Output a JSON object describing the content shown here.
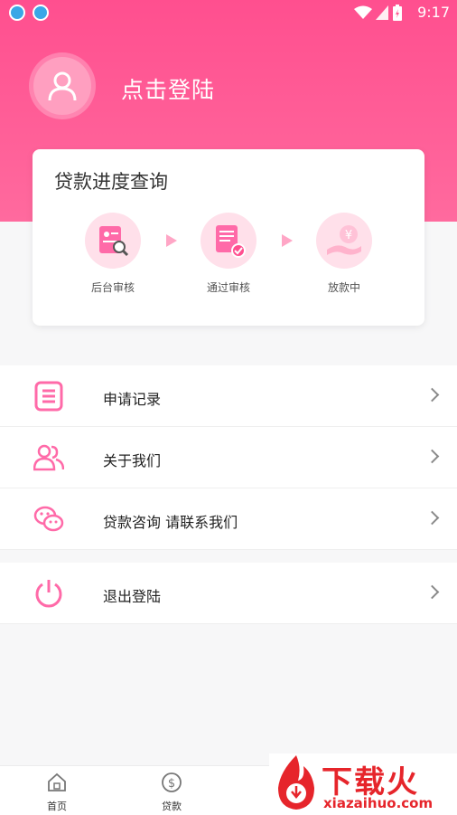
{
  "statusbar": {
    "time": "9:17"
  },
  "header": {
    "login_text": "点击登陆"
  },
  "progress_card": {
    "title": "贷款进度查询",
    "steps": [
      {
        "label": "后台审核",
        "icon": "id-card-search-icon"
      },
      {
        "label": "通过审核",
        "icon": "document-approved-icon"
      },
      {
        "label": "放款中",
        "icon": "yuan-hand-icon"
      }
    ]
  },
  "menu": {
    "items": [
      {
        "label": "申请记录",
        "icon": "list-document-icon"
      },
      {
        "label": "关于我们",
        "icon": "users-icon"
      },
      {
        "label": "贷款咨询 请联系我们",
        "icon": "wechat-icon"
      },
      {
        "label": "退出登陆",
        "icon": "power-icon"
      }
    ]
  },
  "tabbar": {
    "tabs": [
      {
        "label": "首页",
        "icon": "home-icon"
      },
      {
        "label": "贷款",
        "icon": "dollar-circle-icon"
      },
      {
        "label": "",
        "icon": "user-icon"
      }
    ]
  },
  "watermark": {
    "brand": "下载火",
    "url": "xiazaihuo.com"
  },
  "colors": {
    "accent": "#ff5a93",
    "icon_pink": "#ff6aa8",
    "light_pink": "#ffe0ea"
  }
}
